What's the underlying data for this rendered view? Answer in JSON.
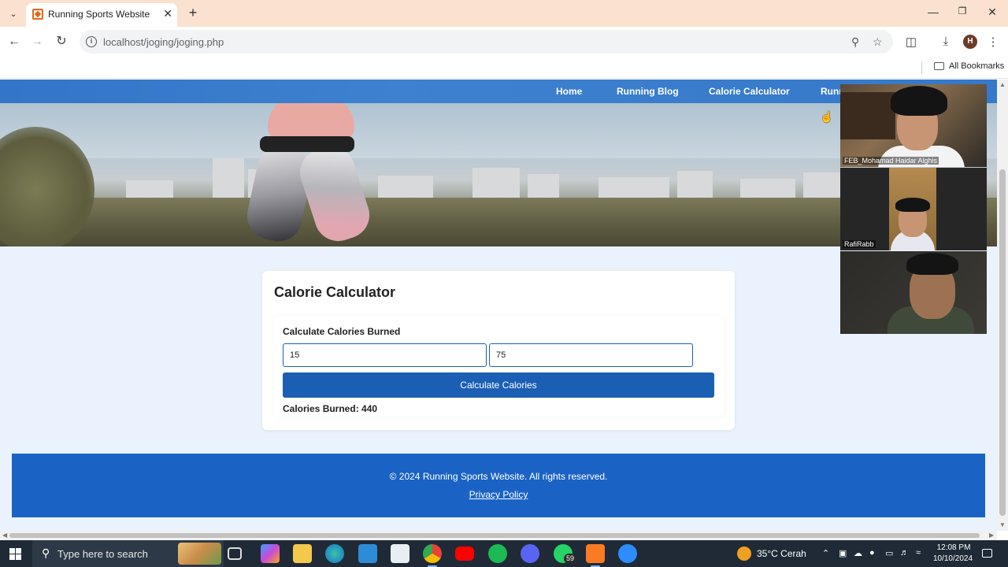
{
  "browser": {
    "tab_title": "Running Sports Website",
    "url": "localhost/joging/joging.php",
    "bookmarks_label": "All Bookmarks",
    "profile_initial": "H"
  },
  "site": {
    "nav": [
      {
        "label": "Home"
      },
      {
        "label": "Running Blog"
      },
      {
        "label": "Calorie Calculator"
      },
      {
        "label": "Runn"
      }
    ],
    "calculator": {
      "title": "Calorie Calculator",
      "section_title": "Calculate Calories Burned",
      "input_1_value": "15",
      "input_2_value": "75",
      "button_label": "Calculate Calories",
      "result_text": "Calories Burned: 440"
    },
    "footer": {
      "copyright": "© 2024 Running Sports Website. All rights reserved.",
      "privacy_link": "Privacy Policy"
    }
  },
  "video_call": {
    "participants": [
      {
        "name": "FEB_Mohamad Haidar Alghis"
      },
      {
        "name": "RafiRabb"
      },
      {
        "name": ""
      }
    ]
  },
  "taskbar": {
    "search_placeholder": "Type here to search",
    "whatsapp_badge": "59",
    "weather": "35°C  Cerah",
    "time": "12:08 PM",
    "date": "10/10/2024"
  },
  "colors": {
    "nav_bar": "#3a7fd0",
    "button": "#1a5fb4",
    "footer": "#1a63c4",
    "page_bg": "#eaf3fd"
  }
}
